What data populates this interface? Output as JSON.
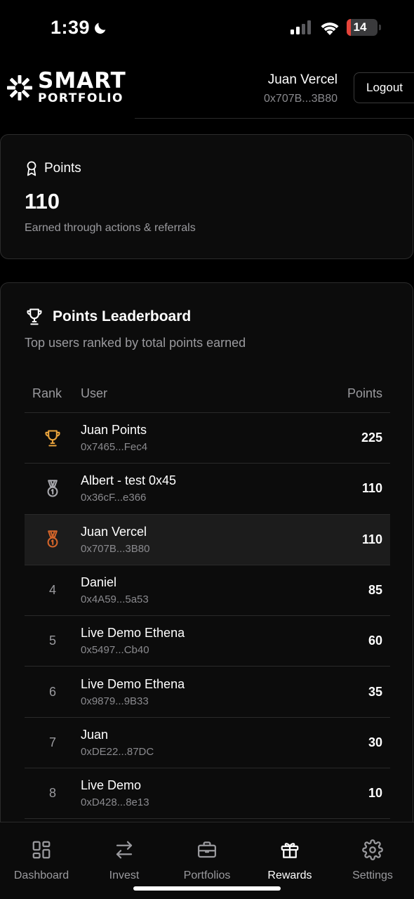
{
  "status_bar": {
    "time": "1:39",
    "battery": "14",
    "battery_level": 0.14
  },
  "header": {
    "logo_smart": "SMART",
    "logo_portfolio": "PORTFOLIO",
    "user_name": "Juan Vercel",
    "user_address": "0x707B...3B80",
    "logout_label": "Logout"
  },
  "points_card": {
    "title": "Points",
    "value": "110",
    "subtitle": "Earned through actions & referrals"
  },
  "leaderboard": {
    "title": "Points Leaderboard",
    "subtitle": "Top users ranked by total points earned",
    "columns": {
      "rank": "Rank",
      "user": "User",
      "points": "Points"
    },
    "rows": [
      {
        "rank": "1",
        "icon": "trophy-icon",
        "icon_color": "#e8a33d",
        "name": "Juan Points",
        "address": "0x7465...Fec4",
        "points": "225"
      },
      {
        "rank": "2",
        "icon": "medal-icon",
        "icon_color": "#a8a8ad",
        "name": "Albert - test 0x45",
        "address": "0x36cF...e366",
        "points": "110"
      },
      {
        "rank": "3",
        "icon": "medal-icon",
        "icon_color": "#d2642a",
        "name": "Juan Vercel",
        "address": "0x707B...3B80",
        "points": "110",
        "highlight": true
      },
      {
        "rank": "4",
        "name": "Daniel",
        "address": "0x4A59...5a53",
        "points": "85"
      },
      {
        "rank": "5",
        "name": "Live Demo Ethena",
        "address": "0x5497...Cb40",
        "points": "60"
      },
      {
        "rank": "6",
        "name": "Live Demo Ethena",
        "address": "0x9879...9B33",
        "points": "35"
      },
      {
        "rank": "7",
        "name": "Juan",
        "address": "0xDE22...87DC",
        "points": "30"
      },
      {
        "rank": "8",
        "name": "Live Demo",
        "address": "0xD428...8e13",
        "points": "10"
      }
    ]
  },
  "bottom_nav": {
    "items": [
      {
        "label": "Dashboard",
        "icon": "dashboard-icon",
        "active": false
      },
      {
        "label": "Invest",
        "icon": "transfer-arrows-icon",
        "active": false
      },
      {
        "label": "Portfolios",
        "icon": "briefcase-icon",
        "active": false
      },
      {
        "label": "Rewards",
        "icon": "gift-icon",
        "active": true
      },
      {
        "label": "Settings",
        "icon": "gear-icon",
        "active": false
      }
    ]
  }
}
